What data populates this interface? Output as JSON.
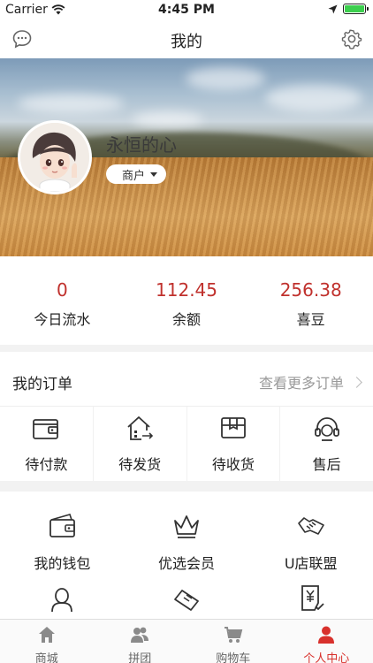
{
  "status_bar": {
    "carrier": "Carrier",
    "time": "4:45 PM"
  },
  "nav": {
    "title": "我的",
    "left_icon": "message-icon",
    "right_icon": "settings-icon"
  },
  "profile": {
    "name": "永恒的心",
    "role": "商户"
  },
  "stats": [
    {
      "value": "0",
      "label": "今日流水"
    },
    {
      "value": "112.45",
      "label": "余额"
    },
    {
      "value": "256.38",
      "label": "喜豆"
    }
  ],
  "orders": {
    "title": "我的订单",
    "more": "查看更多订单",
    "items": [
      {
        "label": "待付款",
        "icon": "wallet-icon"
      },
      {
        "label": "待发货",
        "icon": "ship-box-icon"
      },
      {
        "label": "待收货",
        "icon": "package-icon"
      },
      {
        "label": "售后",
        "icon": "headset-icon"
      }
    ]
  },
  "services": [
    {
      "label": "我的钱包",
      "icon": "purse-icon"
    },
    {
      "label": "优选会员",
      "icon": "crown-icon"
    },
    {
      "label": "U店联盟",
      "icon": "handshake-icon"
    }
  ],
  "tabs": [
    {
      "label": "商城",
      "icon": "home-icon",
      "active": false
    },
    {
      "label": "拼团",
      "icon": "group-icon",
      "active": false
    },
    {
      "label": "购物车",
      "icon": "cart-icon",
      "active": false
    },
    {
      "label": "个人中心",
      "icon": "person-icon",
      "active": true
    }
  ],
  "colors": {
    "accent": "#c0312d",
    "tab_active": "#d8312c"
  }
}
